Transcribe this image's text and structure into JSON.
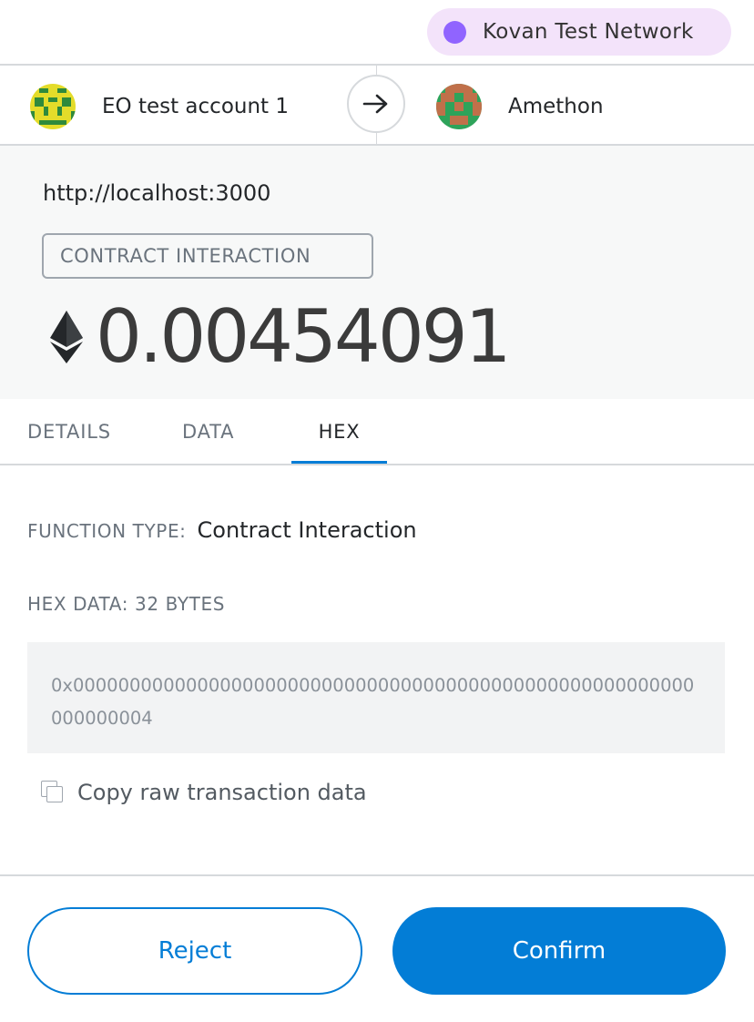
{
  "network": {
    "label": "Kovan Test Network",
    "dot_color": "#9064ff"
  },
  "accounts": {
    "from_name": "EO test account 1",
    "to_name": "Amethon"
  },
  "summary": {
    "origin": "http://localhost:3000",
    "type_badge": "CONTRACT INTERACTION",
    "amount": "0.00454091"
  },
  "tabs": [
    {
      "label": "DETAILS",
      "active": false
    },
    {
      "label": "DATA",
      "active": false
    },
    {
      "label": "HEX",
      "active": true
    }
  ],
  "hex_tab": {
    "function_type_label": "FUNCTION TYPE:",
    "function_type_value": "Contract Interaction",
    "hex_data_label": "HEX DATA: 32 BYTES",
    "hex_data": "0x0000000000000000000000000000000000000000000000000000000000000004",
    "copy_label": "Copy raw transaction data"
  },
  "footer": {
    "reject_label": "Reject",
    "confirm_label": "Confirm"
  },
  "colors": {
    "accent": "#037dd6",
    "network_pill_bg": "#f3e3fa"
  }
}
